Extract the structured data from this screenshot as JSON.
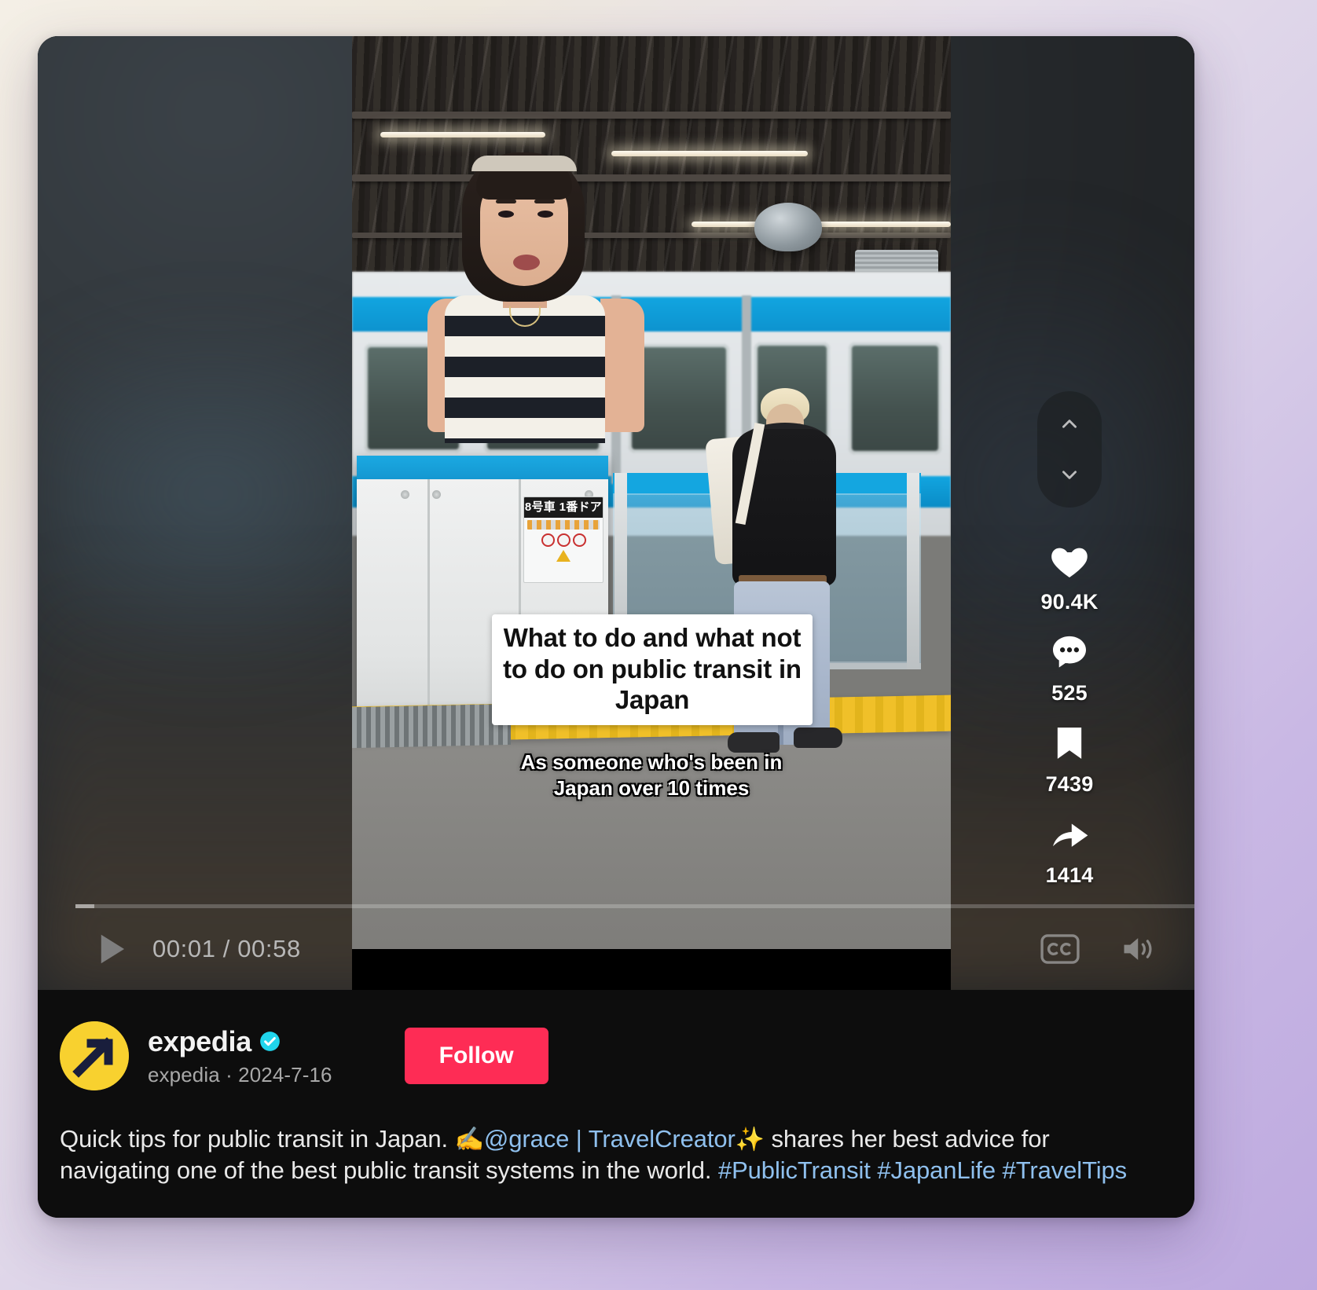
{
  "player": {
    "time_current": "00:01",
    "time_total": "00:58",
    "time_display": "00:01 / 00:58",
    "progress_percent": 1.7,
    "play_icon": "play-icon",
    "captions_label": "CC",
    "captions_icon": "closed-captions-icon",
    "volume_icon": "volume-on-icon"
  },
  "video": {
    "caption_title": "What to do and what not to do on public transit in Japan",
    "caption_subtitle_line1": "As someone who's been in",
    "caption_subtitle_line2": "Japan over 10 times",
    "station_sign": {
      "car_door_label": "8号車 1番ドア"
    }
  },
  "actions": {
    "nav_up_icon": "chevron-up-icon",
    "nav_down_icon": "chevron-down-icon",
    "items": [
      {
        "icon": "heart-icon",
        "name": "like",
        "count": "90.4K"
      },
      {
        "icon": "comment-icon",
        "name": "comment",
        "count": "525"
      },
      {
        "icon": "bookmark-icon",
        "name": "bookmark",
        "count": "7439"
      },
      {
        "icon": "share-icon",
        "name": "share",
        "count": "1414"
      }
    ]
  },
  "meta": {
    "avatar_icon": "expedia-logo-icon",
    "display_name": "expedia",
    "verified_icon": "verified-badge-icon",
    "handle": "expedia",
    "separator": "·",
    "date": "2024-7-16",
    "handle_line": "expedia · 2024-7-16",
    "follow_label": "Follow"
  },
  "caption": {
    "segment_1": "Quick tips for public transit in Japan. ",
    "emoji_1": "✍️",
    "mention": "@grace",
    "separator": " | ",
    "creator_tag": "TravelCreator",
    "emoji_2": "✨",
    "segment_2": " shares her best advice for navigating one of the best public transit systems in the world. ",
    "hashtags": [
      "#PublicTransit",
      "#JapanLife",
      "#TravelTips"
    ]
  },
  "colors": {
    "follow_red": "#fe2c55",
    "link_blue": "#8fc0ee",
    "verified_blue": "#20d5ec",
    "brand_yellow": "#f8d12f",
    "brand_navy": "#191e3c",
    "panel_black": "#0d0d0d"
  }
}
